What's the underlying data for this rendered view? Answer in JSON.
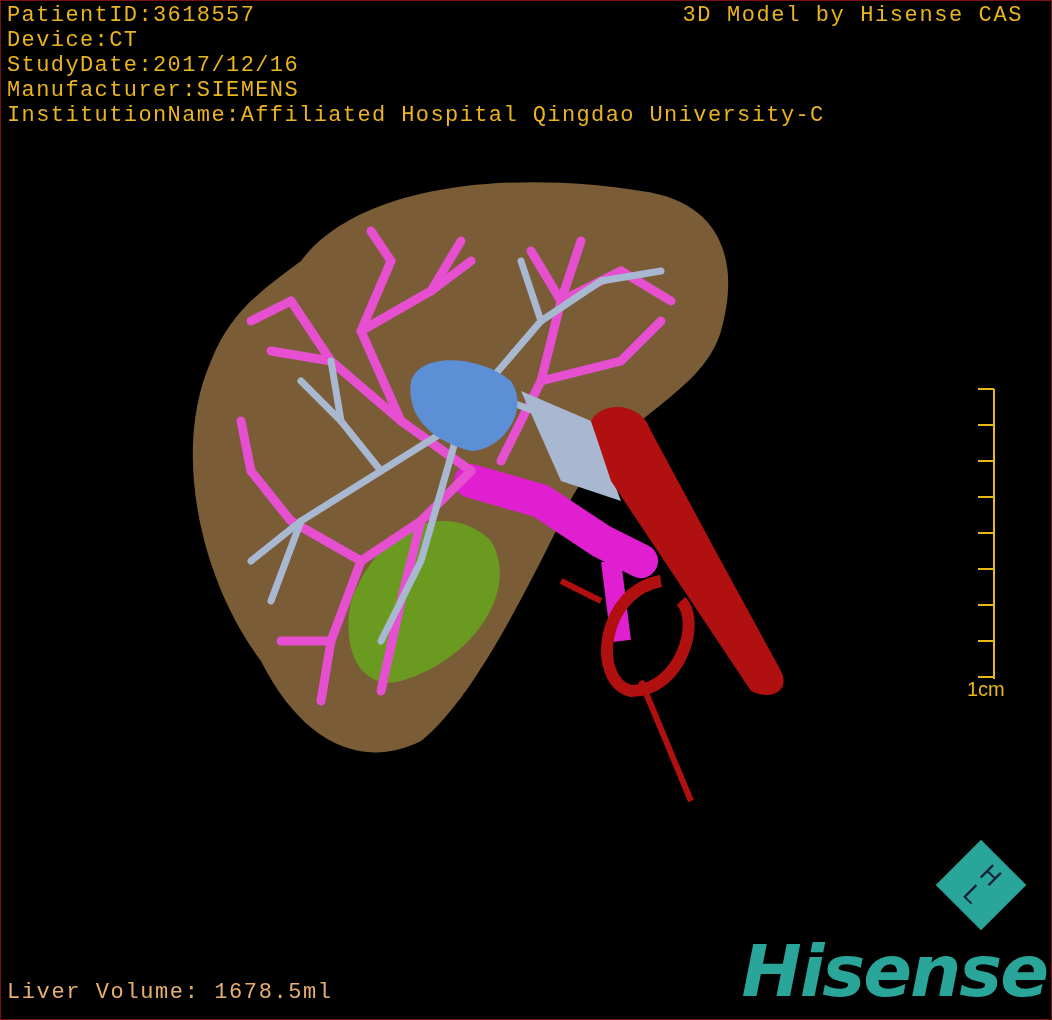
{
  "overlay_info": [
    "PatientID:3618557",
    "Device:CT",
    "StudyDate:2017/12/16",
    "Manufacturer:SIEMENS",
    "InstitutionName:Affiliated Hospital Qingdao University-C"
  ],
  "model_credit": "3D Model by Hisense CAS",
  "scale_bar": {
    "label": "1cm"
  },
  "liver_volume": "Liver Volume: 1678.5ml",
  "logo": {
    "mark": [
      "H",
      "L"
    ],
    "wordmark": "Hisense"
  }
}
